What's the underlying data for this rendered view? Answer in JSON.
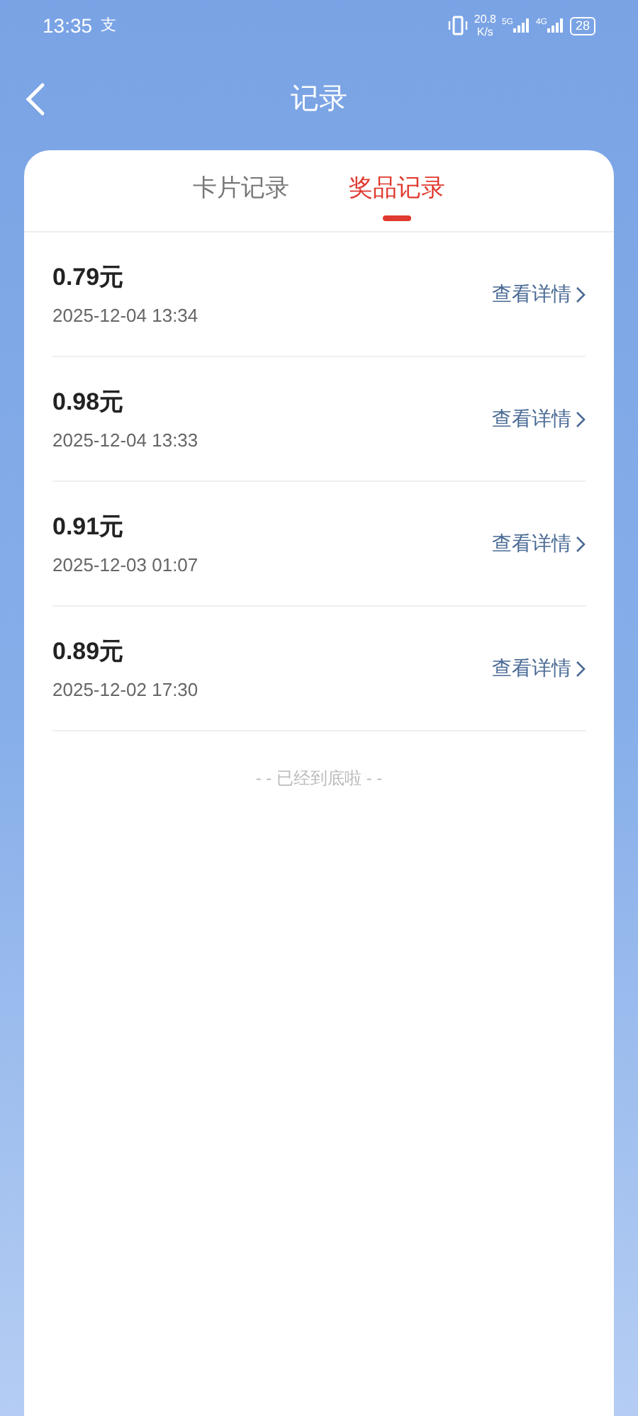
{
  "status_bar": {
    "time": "13:35",
    "notification": "支",
    "speed": "20.8",
    "speed_unit": "K/s",
    "network_1": "5G",
    "network_2": "4G",
    "battery": "28"
  },
  "header": {
    "title": "记录"
  },
  "tabs": [
    {
      "label": "卡片记录",
      "selected": false
    },
    {
      "label": "奖品记录",
      "selected": true
    }
  ],
  "records": [
    {
      "amount": "0.79元",
      "time": "2025-12-04 13:34",
      "action": "查看详情"
    },
    {
      "amount": "0.98元",
      "time": "2025-12-04 13:33",
      "action": "查看详情"
    },
    {
      "amount": "0.91元",
      "time": "2025-12-03 01:07",
      "action": "查看详情"
    },
    {
      "amount": "0.89元",
      "time": "2025-12-02 17:30",
      "action": "查看详情"
    }
  ],
  "footer": "- - 已经到底啦 - -"
}
